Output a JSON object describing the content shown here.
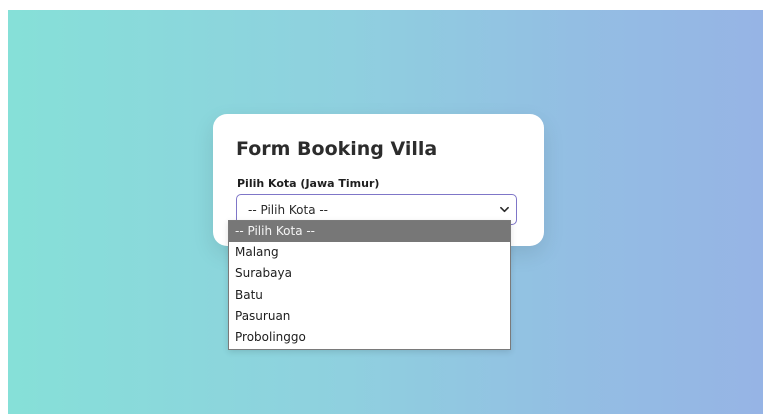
{
  "form": {
    "title": "Form Booking Villa",
    "city_label": "Pilih Kota (Jawa Timur)",
    "city_select": {
      "current_value": "-- Pilih Kota --",
      "expanded": true,
      "options": [
        "-- Pilih Kota --",
        "Malang",
        "Surabaya",
        "Batu",
        "Pasuruan",
        "Probolinggo"
      ],
      "highlighted_option": "-- Pilih Kota --"
    }
  },
  "colors": {
    "background_gradient_start": "#86e0d8",
    "background_gradient_end": "#96b4e5",
    "select_border": "#7f76c8",
    "selected_option_bg": "#777777"
  },
  "icons": {
    "select_chevron": "chevron-down-icon"
  }
}
